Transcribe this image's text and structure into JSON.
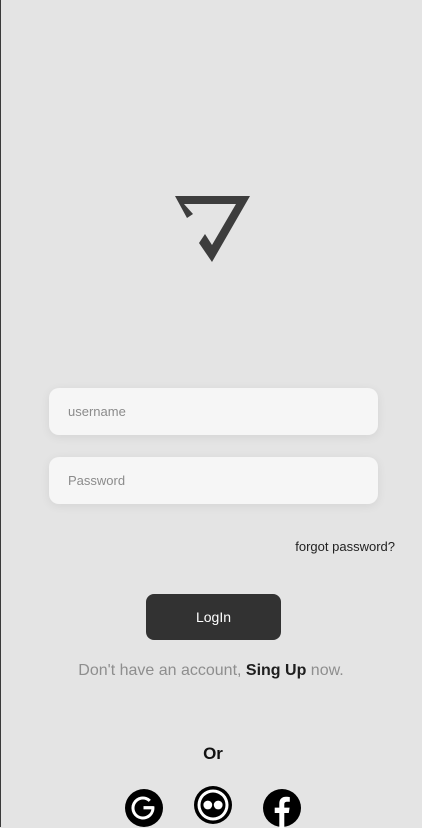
{
  "form": {
    "username_placeholder": "username",
    "password_placeholder": "Password",
    "forgot_label": "forgot password?",
    "login_label": "LogIn"
  },
  "signup": {
    "prefix": "Don't have an account, ",
    "link_label": "Sing Up",
    "suffix": " now."
  },
  "social": {
    "or_label": "Or",
    "icons": [
      "google-icon",
      "flickr-icon",
      "facebook-icon"
    ]
  },
  "colors": {
    "background": "#e4e4e4",
    "field_background": "#f6f6f6",
    "button_background": "#323232",
    "logo": "#3d3d3d"
  }
}
